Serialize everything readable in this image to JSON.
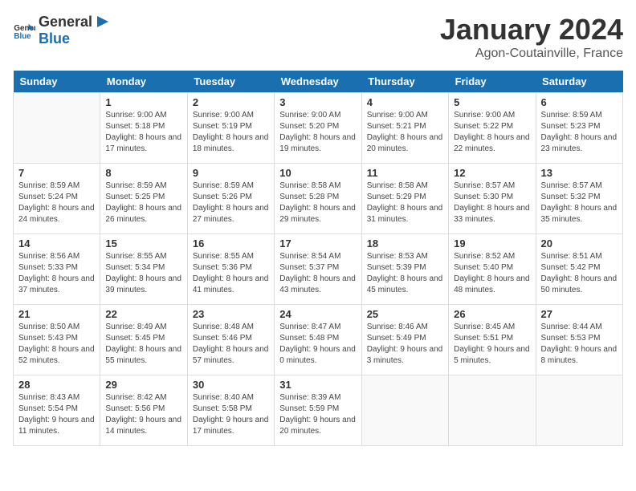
{
  "header": {
    "logo_general": "General",
    "logo_blue": "Blue",
    "month_title": "January 2024",
    "location": "Agon-Coutainville, France"
  },
  "days_of_week": [
    "Sunday",
    "Monday",
    "Tuesday",
    "Wednesday",
    "Thursday",
    "Friday",
    "Saturday"
  ],
  "weeks": [
    [
      {
        "day": "",
        "sunrise": "",
        "sunset": "",
        "daylight": ""
      },
      {
        "day": "1",
        "sunrise": "Sunrise: 9:00 AM",
        "sunset": "Sunset: 5:18 PM",
        "daylight": "Daylight: 8 hours and 17 minutes."
      },
      {
        "day": "2",
        "sunrise": "Sunrise: 9:00 AM",
        "sunset": "Sunset: 5:19 PM",
        "daylight": "Daylight: 8 hours and 18 minutes."
      },
      {
        "day": "3",
        "sunrise": "Sunrise: 9:00 AM",
        "sunset": "Sunset: 5:20 PM",
        "daylight": "Daylight: 8 hours and 19 minutes."
      },
      {
        "day": "4",
        "sunrise": "Sunrise: 9:00 AM",
        "sunset": "Sunset: 5:21 PM",
        "daylight": "Daylight: 8 hours and 20 minutes."
      },
      {
        "day": "5",
        "sunrise": "Sunrise: 9:00 AM",
        "sunset": "Sunset: 5:22 PM",
        "daylight": "Daylight: 8 hours and 22 minutes."
      },
      {
        "day": "6",
        "sunrise": "Sunrise: 8:59 AM",
        "sunset": "Sunset: 5:23 PM",
        "daylight": "Daylight: 8 hours and 23 minutes."
      }
    ],
    [
      {
        "day": "7",
        "sunrise": "Sunrise: 8:59 AM",
        "sunset": "Sunset: 5:24 PM",
        "daylight": "Daylight: 8 hours and 24 minutes."
      },
      {
        "day": "8",
        "sunrise": "Sunrise: 8:59 AM",
        "sunset": "Sunset: 5:25 PM",
        "daylight": "Daylight: 8 hours and 26 minutes."
      },
      {
        "day": "9",
        "sunrise": "Sunrise: 8:59 AM",
        "sunset": "Sunset: 5:26 PM",
        "daylight": "Daylight: 8 hours and 27 minutes."
      },
      {
        "day": "10",
        "sunrise": "Sunrise: 8:58 AM",
        "sunset": "Sunset: 5:28 PM",
        "daylight": "Daylight: 8 hours and 29 minutes."
      },
      {
        "day": "11",
        "sunrise": "Sunrise: 8:58 AM",
        "sunset": "Sunset: 5:29 PM",
        "daylight": "Daylight: 8 hours and 31 minutes."
      },
      {
        "day": "12",
        "sunrise": "Sunrise: 8:57 AM",
        "sunset": "Sunset: 5:30 PM",
        "daylight": "Daylight: 8 hours and 33 minutes."
      },
      {
        "day": "13",
        "sunrise": "Sunrise: 8:57 AM",
        "sunset": "Sunset: 5:32 PM",
        "daylight": "Daylight: 8 hours and 35 minutes."
      }
    ],
    [
      {
        "day": "14",
        "sunrise": "Sunrise: 8:56 AM",
        "sunset": "Sunset: 5:33 PM",
        "daylight": "Daylight: 8 hours and 37 minutes."
      },
      {
        "day": "15",
        "sunrise": "Sunrise: 8:55 AM",
        "sunset": "Sunset: 5:34 PM",
        "daylight": "Daylight: 8 hours and 39 minutes."
      },
      {
        "day": "16",
        "sunrise": "Sunrise: 8:55 AM",
        "sunset": "Sunset: 5:36 PM",
        "daylight": "Daylight: 8 hours and 41 minutes."
      },
      {
        "day": "17",
        "sunrise": "Sunrise: 8:54 AM",
        "sunset": "Sunset: 5:37 PM",
        "daylight": "Daylight: 8 hours and 43 minutes."
      },
      {
        "day": "18",
        "sunrise": "Sunrise: 8:53 AM",
        "sunset": "Sunset: 5:39 PM",
        "daylight": "Daylight: 8 hours and 45 minutes."
      },
      {
        "day": "19",
        "sunrise": "Sunrise: 8:52 AM",
        "sunset": "Sunset: 5:40 PM",
        "daylight": "Daylight: 8 hours and 48 minutes."
      },
      {
        "day": "20",
        "sunrise": "Sunrise: 8:51 AM",
        "sunset": "Sunset: 5:42 PM",
        "daylight": "Daylight: 8 hours and 50 minutes."
      }
    ],
    [
      {
        "day": "21",
        "sunrise": "Sunrise: 8:50 AM",
        "sunset": "Sunset: 5:43 PM",
        "daylight": "Daylight: 8 hours and 52 minutes."
      },
      {
        "day": "22",
        "sunrise": "Sunrise: 8:49 AM",
        "sunset": "Sunset: 5:45 PM",
        "daylight": "Daylight: 8 hours and 55 minutes."
      },
      {
        "day": "23",
        "sunrise": "Sunrise: 8:48 AM",
        "sunset": "Sunset: 5:46 PM",
        "daylight": "Daylight: 8 hours and 57 minutes."
      },
      {
        "day": "24",
        "sunrise": "Sunrise: 8:47 AM",
        "sunset": "Sunset: 5:48 PM",
        "daylight": "Daylight: 9 hours and 0 minutes."
      },
      {
        "day": "25",
        "sunrise": "Sunrise: 8:46 AM",
        "sunset": "Sunset: 5:49 PM",
        "daylight": "Daylight: 9 hours and 3 minutes."
      },
      {
        "day": "26",
        "sunrise": "Sunrise: 8:45 AM",
        "sunset": "Sunset: 5:51 PM",
        "daylight": "Daylight: 9 hours and 5 minutes."
      },
      {
        "day": "27",
        "sunrise": "Sunrise: 8:44 AM",
        "sunset": "Sunset: 5:53 PM",
        "daylight": "Daylight: 9 hours and 8 minutes."
      }
    ],
    [
      {
        "day": "28",
        "sunrise": "Sunrise: 8:43 AM",
        "sunset": "Sunset: 5:54 PM",
        "daylight": "Daylight: 9 hours and 11 minutes."
      },
      {
        "day": "29",
        "sunrise": "Sunrise: 8:42 AM",
        "sunset": "Sunset: 5:56 PM",
        "daylight": "Daylight: 9 hours and 14 minutes."
      },
      {
        "day": "30",
        "sunrise": "Sunrise: 8:40 AM",
        "sunset": "Sunset: 5:58 PM",
        "daylight": "Daylight: 9 hours and 17 minutes."
      },
      {
        "day": "31",
        "sunrise": "Sunrise: 8:39 AM",
        "sunset": "Sunset: 5:59 PM",
        "daylight": "Daylight: 9 hours and 20 minutes."
      },
      {
        "day": "",
        "sunrise": "",
        "sunset": "",
        "daylight": ""
      },
      {
        "day": "",
        "sunrise": "",
        "sunset": "",
        "daylight": ""
      },
      {
        "day": "",
        "sunrise": "",
        "sunset": "",
        "daylight": ""
      }
    ]
  ]
}
